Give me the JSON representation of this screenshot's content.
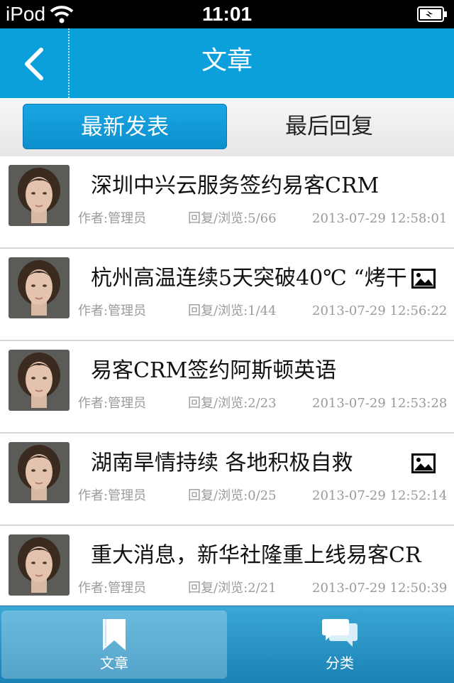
{
  "status_bar": {
    "carrier": "iPod",
    "time": "11:01"
  },
  "nav": {
    "title": "文章"
  },
  "segments": {
    "latest": "最新发表",
    "last_reply": "最后回复"
  },
  "articles": [
    {
      "title": "深圳中兴云服务签约易客CRM",
      "author": "作者:管理员",
      "stats": "回复/浏览:5/66",
      "date": "2013-07-29 12:58:01",
      "has_image": false
    },
    {
      "title": "杭州高温连续5天突破40℃ “烤干",
      "author": "作者:管理员",
      "stats": "回复/浏览:1/44",
      "date": "2013-07-29 12:56:22",
      "has_image": true
    },
    {
      "title": "易客CRM签约阿斯顿英语",
      "author": "作者:管理员",
      "stats": "回复/浏览:2/23",
      "date": "2013-07-29 12:53:28",
      "has_image": false
    },
    {
      "title": "湖南旱情持续 各地积极自救",
      "author": "作者:管理员",
      "stats": "回复/浏览:0/25",
      "date": "2013-07-29 12:52:14",
      "has_image": true
    },
    {
      "title": "重大消息，新华社隆重上线易客CR",
      "author": "作者:管理员",
      "stats": "回复/浏览:2/21",
      "date": "2013-07-29 12:50:39",
      "has_image": false
    }
  ],
  "tabs": {
    "articles": "文章",
    "categories": "分类"
  },
  "colors": {
    "nav_blue": "#0b9fdc",
    "tabbar_blue": "#2a95c8",
    "meta_gray": "#9a9a9a"
  },
  "icons": {
    "back": "chevron-left-icon",
    "image": "image-icon",
    "bookmark": "bookmark-icon",
    "chat": "chat-bubbles-icon"
  }
}
